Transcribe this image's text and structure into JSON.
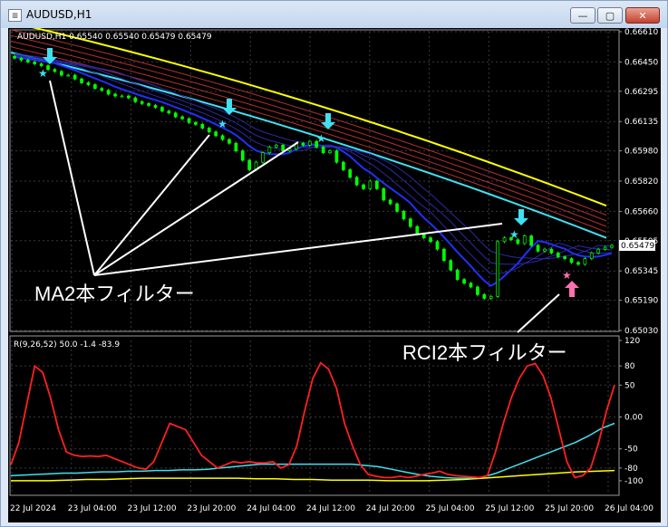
{
  "window": {
    "title": "AUDUSD,H1",
    "buttons": {
      "minimize": "—",
      "maximize": "▢",
      "close": "✕"
    }
  },
  "chart_data": {
    "type": "candlestick",
    "symbol_header": "AUDUSD,H1  0.65540 0.65540 0.65479 0.65479",
    "price_ticks": [
      "0.66610",
      "0.66450",
      "0.66295",
      "0.66135",
      "0.65980",
      "0.65820",
      "0.65660",
      "0.65505",
      "0.65345",
      "0.65190",
      "0.65030"
    ],
    "price_range": [
      0.6503,
      0.6661
    ],
    "current_price": "0.65479",
    "x_labels": [
      "22 Jul 2024",
      "23 Jul 04:00",
      "23 Jul 12:00",
      "23 Jul 20:00",
      "24 Jul 04:00",
      "24 Jul 12:00",
      "24 Jul 20:00",
      "25 Jul 04:00",
      "25 Jul 12:00",
      "25 Jul 20:00",
      "26 Jul 04:00"
    ],
    "closes": [
      0.6647,
      0.6646,
      0.6645,
      0.6644,
      0.6643,
      0.6641,
      0.664,
      0.6638,
      0.6638,
      0.6636,
      0.6634,
      0.6633,
      0.6631,
      0.663,
      0.6628,
      0.6627,
      0.6627,
      0.6626,
      0.6624,
      0.6623,
      0.6622,
      0.6621,
      0.6619,
      0.6618,
      0.6616,
      0.6615,
      0.6613,
      0.6612,
      0.661,
      0.6608,
      0.6606,
      0.6604,
      0.6602,
      0.6598,
      0.6593,
      0.6588,
      0.6592,
      0.6597,
      0.66,
      0.6601,
      0.6598,
      0.6599,
      0.6602,
      0.6601,
      0.6603,
      0.66,
      0.6597,
      0.6598,
      0.6592,
      0.6588,
      0.6584,
      0.658,
      0.6578,
      0.6582,
      0.6578,
      0.6572,
      0.657,
      0.6566,
      0.6562,
      0.6558,
      0.6554,
      0.6552,
      0.655,
      0.6546,
      0.654,
      0.6535,
      0.653,
      0.6528,
      0.6526,
      0.6522,
      0.652,
      0.6521,
      0.655,
      0.6552,
      0.6551,
      0.6549,
      0.6553,
      0.6548,
      0.6545,
      0.6546,
      0.6544,
      0.6542,
      0.6541,
      0.6539,
      0.6538,
      0.6541,
      0.6544,
      0.6546,
      0.6547,
      0.6548
    ],
    "ma_lines": [
      {
        "name": "yellow",
        "color": "#ffff00",
        "start": 0.6666,
        "end": 0.6569
      },
      {
        "name": "red1",
        "color": "#b03030",
        "start": 0.6662,
        "end": 0.6564
      },
      {
        "name": "red2",
        "color": "#b03030",
        "start": 0.6659,
        "end": 0.6561
      },
      {
        "name": "red3",
        "color": "#b03030",
        "start": 0.6656,
        "end": 0.6558
      },
      {
        "name": "red4",
        "color": "#b03030",
        "start": 0.6653,
        "end": 0.6555
      },
      {
        "name": "cyan",
        "color": "#40e0f0",
        "start": 0.665,
        "end": 0.6552
      }
    ],
    "signals_down": [
      [
        7,
        0.6651
      ],
      [
        52,
        0.6618
      ],
      [
        76,
        0.661
      ],
      [
        125,
        0.6561
      ]
    ],
    "signals_up": [
      [
        138,
        0.653
      ]
    ],
    "annotations": {
      "ma_filter": "MA2本フィルター",
      "rci_filter": "RCI2本フィルター"
    },
    "rci": {
      "header": "R(9,26,52) 50.0 -1.4 -83.9",
      "range": [
        -120,
        120
      ],
      "ticks": [
        "120",
        "80",
        "50",
        "0.00",
        "-50",
        "-80",
        "-100"
      ],
      "fast": [
        -75,
        -40,
        20,
        80,
        70,
        30,
        -20,
        -55,
        -60,
        -62,
        -61,
        -62,
        -60,
        -65,
        -70,
        -75,
        -80,
        -82,
        -70,
        -40,
        -10,
        -15,
        -20,
        -40,
        -60,
        -70,
        -80,
        -75,
        -70,
        -72,
        -70,
        -72,
        -72,
        -70,
        -80,
        -75,
        -45,
        10,
        60,
        85,
        75,
        45,
        -10,
        -45,
        -75,
        -90,
        -93,
        -95,
        -95,
        -93,
        -95,
        -93,
        -90,
        -88,
        -85,
        -90,
        -92,
        -93,
        -94,
        -95,
        -92,
        -55,
        -10,
        30,
        60,
        80,
        84,
        65,
        30,
        -20,
        -70,
        -95,
        -92,
        -80,
        -40,
        10,
        50
      ],
      "mid": [
        -92,
        -91,
        -90,
        -89,
        -88,
        -88,
        -87,
        -86,
        -86,
        -85,
        -85,
        -84,
        -84,
        -83,
        -83,
        -82,
        -80,
        -78,
        -76,
        -74,
        -74,
        -74,
        -74,
        -74,
        -74,
        -74,
        -74,
        -76,
        -78,
        -82,
        -86,
        -90,
        -93,
        -95,
        -96,
        -96,
        -94,
        -88,
        -80,
        -72,
        -64,
        -56,
        -48,
        -40,
        -30,
        -18,
        -10
      ],
      "slow": [
        -100,
        -100,
        -100,
        -99,
        -98,
        -98,
        -97,
        -96,
        -96,
        -96,
        -96,
        -96,
        -96,
        -97,
        -97,
        -98,
        -98,
        -99,
        -99,
        -99,
        -100,
        -100,
        -100,
        -99,
        -98,
        -96,
        -94,
        -92,
        -90,
        -88,
        -86,
        -85,
        -84
      ]
    }
  }
}
